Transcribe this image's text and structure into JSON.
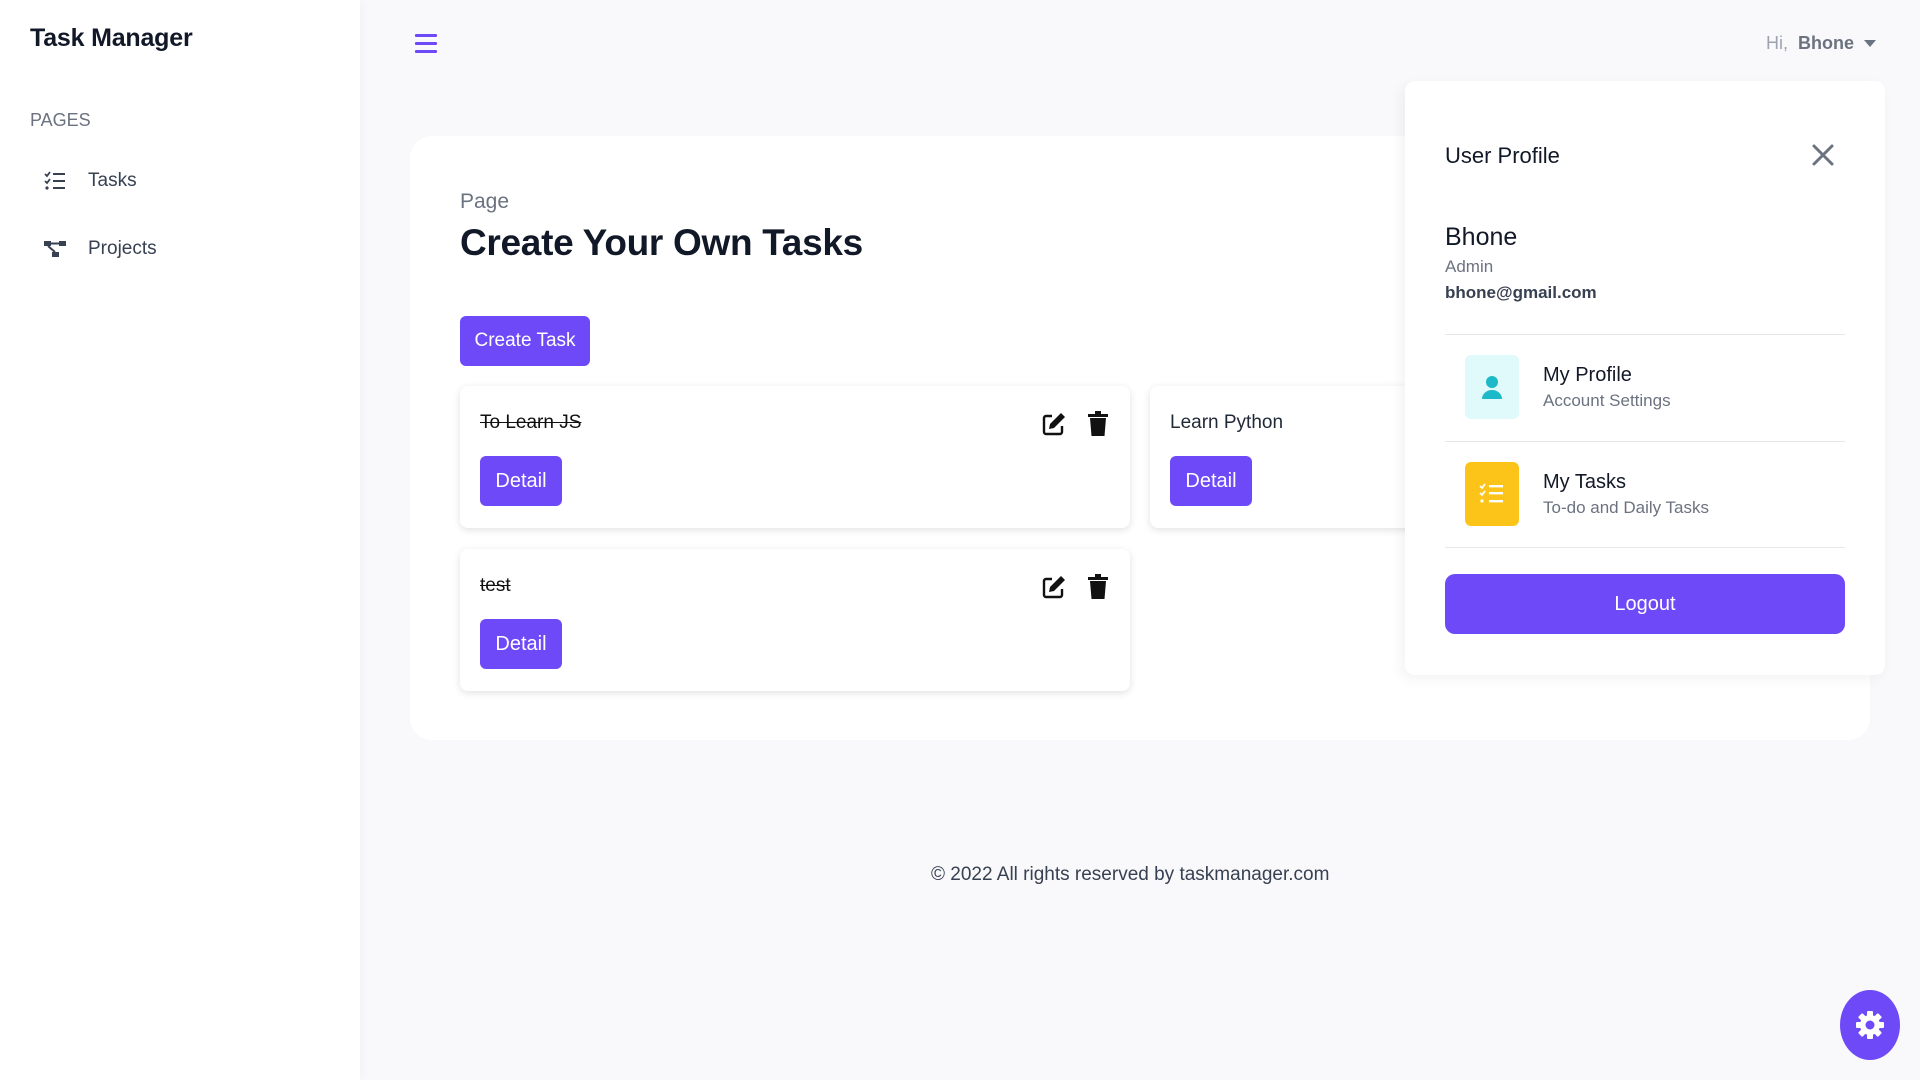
{
  "app": {
    "title": "Task Manager"
  },
  "sidebar": {
    "section_label": "PAGES",
    "items": [
      {
        "label": "Tasks",
        "icon": "list-check-icon"
      },
      {
        "label": "Projects",
        "icon": "diagram-icon"
      }
    ]
  },
  "topbar": {
    "greeting": "Hi,",
    "user": "Bhone"
  },
  "main": {
    "kicker": "Page",
    "title": "Create Your Own Tasks",
    "create_button": "Create Task",
    "tasks": [
      {
        "title": "To Learn JS",
        "done": true,
        "detail": "Detail"
      },
      {
        "title": "Learn Python",
        "done": false,
        "detail": "Detail"
      },
      {
        "title": "test",
        "done": true,
        "detail": "Detail"
      }
    ]
  },
  "footer": {
    "text": "© 2022 All rights reserved by taskmanager.com"
  },
  "profile": {
    "title": "User Profile",
    "name": "Bhone",
    "role": "Admin",
    "email": "bhone@gmail.com",
    "menu": [
      {
        "title": "My Profile",
        "subtitle": "Account Settings",
        "icon": "user-icon"
      },
      {
        "title": "My Tasks",
        "subtitle": "To-do and Daily Tasks",
        "icon": "list-icon"
      }
    ],
    "logout": "Logout"
  },
  "colors": {
    "accent": "#6e49f7",
    "teal_bg": "#e0fafb",
    "teal": "#1cbac8",
    "yellow": "#fcc419"
  }
}
